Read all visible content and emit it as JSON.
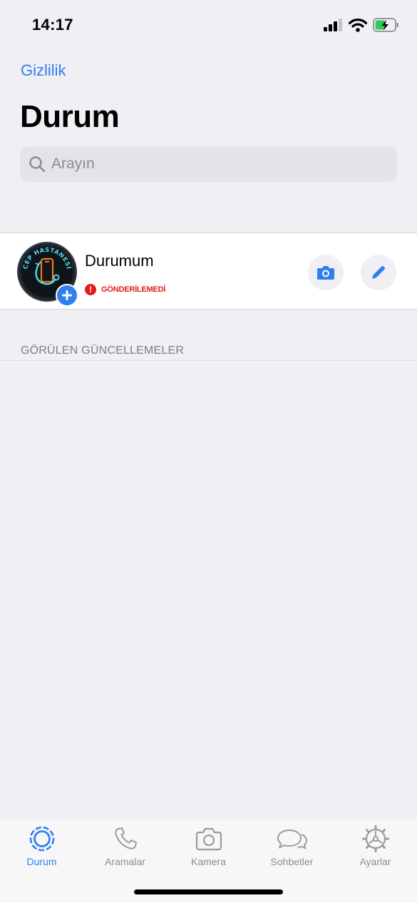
{
  "status_bar": {
    "time": "14:17"
  },
  "header": {
    "privacy_link": "Gizlilik",
    "title": "Durum",
    "search_placeholder": "Arayın"
  },
  "my_status": {
    "name": "Durumum",
    "error_text": "GÖNDERİLEMEDİ",
    "avatar_text": "CEP HASTANESİ"
  },
  "sections": {
    "viewed_updates": "GÖRÜLEN GÜNCELLEMELER"
  },
  "tabs": [
    {
      "label": "Durum",
      "icon": "status-icon",
      "active": true
    },
    {
      "label": "Aramalar",
      "icon": "phone-icon",
      "active": false
    },
    {
      "label": "Kamera",
      "icon": "camera-icon",
      "active": false
    },
    {
      "label": "Sohbetler",
      "icon": "chats-icon",
      "active": false
    },
    {
      "label": "Ayarlar",
      "icon": "settings-icon",
      "active": false
    }
  ],
  "colors": {
    "accent": "#2f7ff0",
    "error": "#e31b1b",
    "background": "#efeff4"
  }
}
